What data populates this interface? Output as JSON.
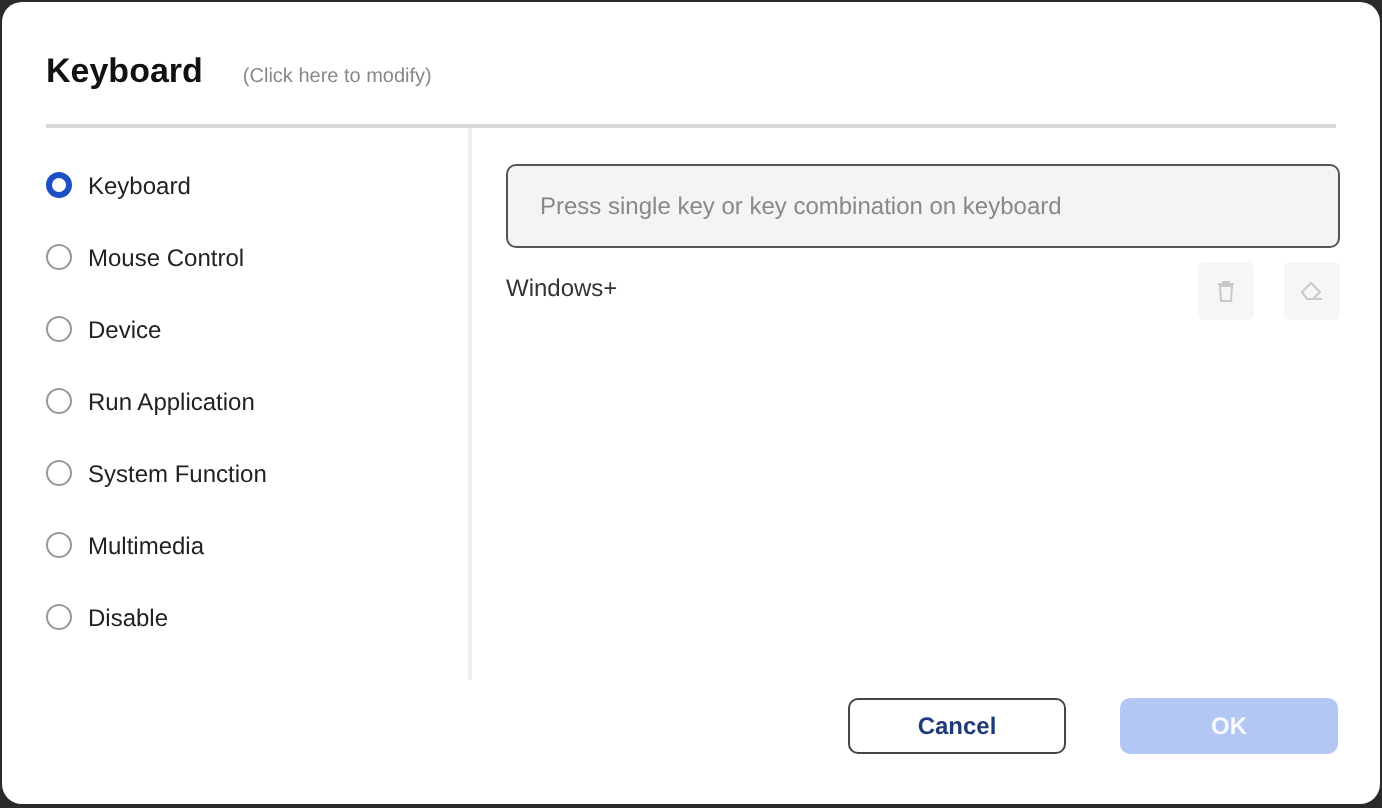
{
  "dialog": {
    "title": "Keyboard",
    "hint": "(Click here to modify)"
  },
  "options": [
    {
      "label": "Keyboard",
      "selected": true
    },
    {
      "label": "Mouse Control",
      "selected": false
    },
    {
      "label": "Device",
      "selected": false
    },
    {
      "label": "Run Application",
      "selected": false
    },
    {
      "label": "System Function",
      "selected": false
    },
    {
      "label": "Multimedia",
      "selected": false
    },
    {
      "label": "Disable",
      "selected": false
    }
  ],
  "key_field": {
    "placeholder": "Press single key or key combination on keyboard"
  },
  "modifier_text": "Windows+",
  "tool_buttons": [
    {
      "kind": "delete",
      "disabled": true
    },
    {
      "kind": "erase",
      "disabled": true
    }
  ],
  "buttons": [
    {
      "label": "Cancel",
      "kind": "secondary",
      "disabled": false
    },
    {
      "label": "OK",
      "kind": "primary",
      "disabled": true
    }
  ]
}
